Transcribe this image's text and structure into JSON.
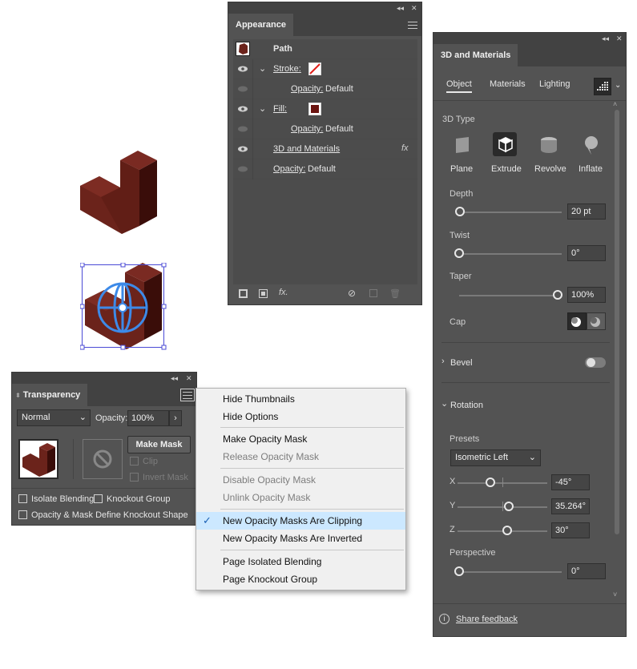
{
  "appearance": {
    "title": "Appearance",
    "path_label": "Path",
    "stroke_label": "Stroke:",
    "opacity_label": "Opacity:",
    "opacity_value": "Default",
    "fill_label": "Fill:",
    "effect_label": "3D and Materials",
    "fx_symbol": "fx",
    "bottom_fx": "fx."
  },
  "materials": {
    "title": "3D and Materials",
    "tabs": [
      "Object",
      "Materials",
      "Lighting"
    ],
    "type_heading": "3D Type",
    "types": [
      "Plane",
      "Extrude",
      "Revolve",
      "Inflate"
    ],
    "depth_label": "Depth",
    "depth_value": "20 pt",
    "twist_label": "Twist",
    "twist_value": "0°",
    "taper_label": "Taper",
    "taper_value": "100%",
    "cap_label": "Cap",
    "bevel_label": "Bevel",
    "bevel_on": false,
    "rotation_label": "Rotation",
    "presets_label": "Presets",
    "preset_value": "Isometric Left",
    "x_label": "X",
    "x_value": "-45°",
    "y_label": "Y",
    "y_value": "35.264°",
    "z_label": "Z",
    "z_value": "30°",
    "perspective_label": "Perspective",
    "perspective_value": "0°",
    "feedback": "Share feedback"
  },
  "transparency": {
    "title": "Transparency",
    "blend_mode": "Normal",
    "opacity_label": "Opacity:",
    "opacity_value": "100%",
    "make_mask": "Make Mask",
    "clip": "Clip",
    "invert_mask": "Invert Mask",
    "isolate": "Isolate Blending",
    "knockout": "Knockout Group",
    "knockout_shape": "Opacity & Mask Define Knockout Shape"
  },
  "menu": {
    "items": [
      "Hide Thumbnails",
      "Hide Options",
      "Make Opacity Mask",
      "Release Opacity Mask",
      "Disable Opacity Mask",
      "Unlink Opacity Mask",
      "New Opacity Masks Are Clipping",
      "New Opacity Masks Are Inverted",
      "Page Isolated Blending",
      "Page Knockout Group"
    ]
  },
  "colors": {
    "panel_bg": "#535353",
    "object_fill": "#5a1a14",
    "selection": "#2f6fd6"
  }
}
